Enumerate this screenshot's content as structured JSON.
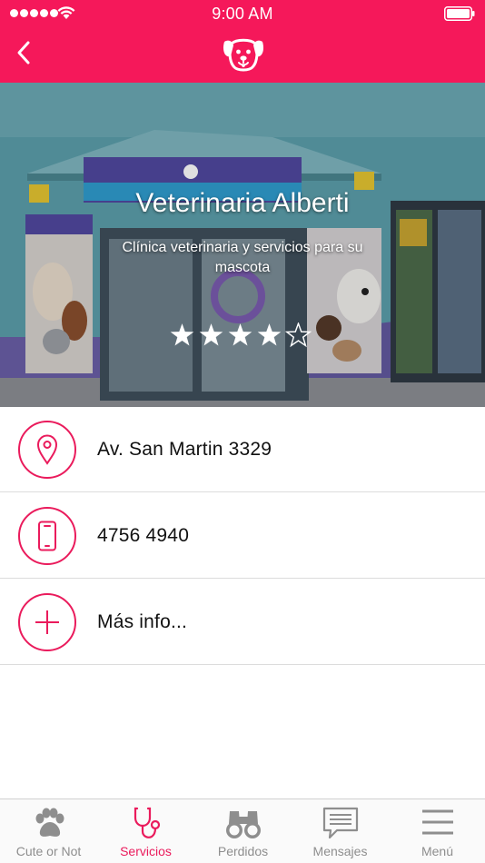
{
  "status_bar": {
    "time": "9:00 AM"
  },
  "nav": {
    "back_label": "",
    "logo_icon": "dog-face-icon"
  },
  "hero": {
    "title": "Veterinaria Alberti",
    "subtitle": "Clínica veterinaria y servicios para su mascota",
    "rating": 4,
    "rating_max": 5,
    "sign_text": "Veterinaria Alberti"
  },
  "info": {
    "address": "Av. San Martin 3329",
    "phone": "4756 4940",
    "more": "Más info..."
  },
  "tabs": [
    {
      "label": "Cute or Not",
      "icon": "paw-icon",
      "active": false
    },
    {
      "label": "Servicios",
      "icon": "stethoscope-icon",
      "active": true
    },
    {
      "label": "Perdidos",
      "icon": "binoculars-icon",
      "active": false
    },
    {
      "label": "Mensajes",
      "icon": "message-icon",
      "active": false
    },
    {
      "label": "Menú",
      "icon": "menu-icon",
      "active": false
    }
  ],
  "colors": {
    "accent": "#f5185a",
    "row_icon": "#ea1b5c",
    "tab_inactive": "#8e8e8e"
  }
}
